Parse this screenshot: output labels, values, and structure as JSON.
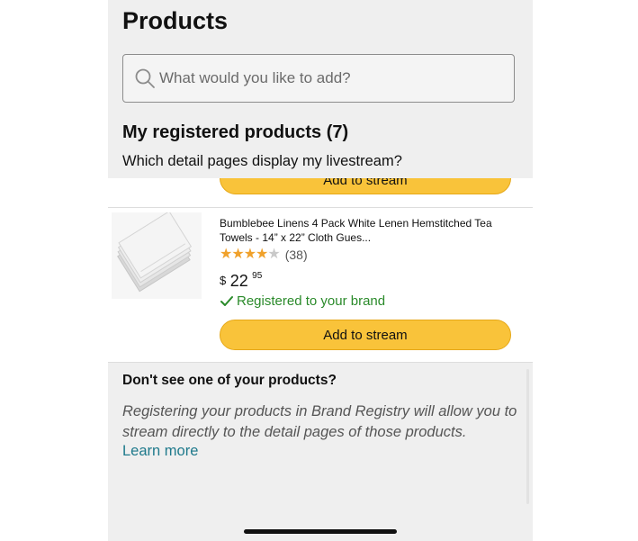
{
  "page": {
    "title": "Products"
  },
  "search": {
    "placeholder": "What would you like to add?"
  },
  "registered": {
    "heading": "My registered products (7)",
    "subheading": "Which detail pages display my livestream?"
  },
  "products": [
    {
      "title": "Bumblebee Linens 4 Pack White Lenen Hemstitched Tea Towels - 14” x 22” Cloth Gues...",
      "rating_value": 4,
      "rating_max": 5,
      "rating_count": "(38)",
      "price_symbol": "$",
      "price_whole": "22",
      "price_fraction": "95",
      "status": "Registered to your brand",
      "button_label": "Add to stream"
    }
  ],
  "partial_button": {
    "label": "Add to stream"
  },
  "help": {
    "heading": "Don't see one of your products?",
    "text": "Registering your products in Brand Registry will allow you to stream directly to the detail pages of those products.",
    "link": "Learn more"
  },
  "colors": {
    "accent_button": "#f9c33a",
    "success": "#2a8a2a",
    "link": "#1f7a8c",
    "star": "#f0a12b"
  },
  "icons": [
    "search-icon",
    "check-icon",
    "star-icon"
  ]
}
